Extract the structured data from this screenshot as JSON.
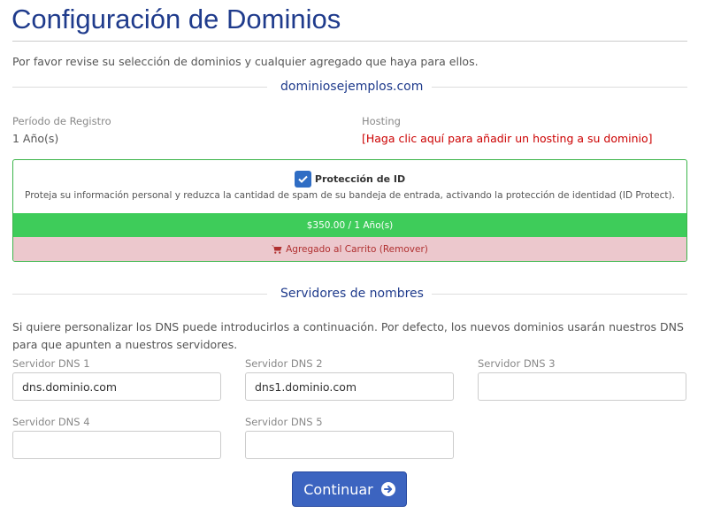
{
  "page": {
    "title": "Configuración de Dominios",
    "intro": "Por favor revise su selección de dominios y cualquier agregado que haya para ellos."
  },
  "domain": {
    "name": "dominiosejemplos.com",
    "period_label": "Período de Registro",
    "period_value": "1 Año(s)",
    "hosting_label": "Hosting",
    "hosting_link": "[Haga clic aquí para añadir un hosting a su dominio]"
  },
  "addon": {
    "name": "Protección de ID",
    "checked": true,
    "description": "Proteja su información personal y reduzca la cantidad de spam de su bandeja de entrada, activando la protección de identidad (ID Protect).",
    "price": "$350.00 / 1 Año(s)",
    "cart_text": "Agregado al Carrito (Remover)",
    "cart_icon": "shopping-cart-icon",
    "price_color": "#3ecc5a",
    "cart_color": "#ecc8cd"
  },
  "nameservers": {
    "title": "Servidores de nombres",
    "description": "Si quiere personalizar los DNS puede introducirlos a continuación. Por defecto, los nuevos dominios usarán nuestros DNS para que apunten a nuestros servidores.",
    "fields": [
      {
        "label": "Servidor DNS 1",
        "value": "dns.dominio.com"
      },
      {
        "label": "Servidor DNS 2",
        "value": "dns1.dominio.com"
      },
      {
        "label": "Servidor DNS 3",
        "value": ""
      },
      {
        "label": "Servidor DNS 4",
        "value": ""
      },
      {
        "label": "Servidor DNS 5",
        "value": ""
      }
    ]
  },
  "actions": {
    "continue_label": "Continuar",
    "continue_icon": "arrow-circle-right-icon",
    "accent_color": "#3c64c0"
  }
}
